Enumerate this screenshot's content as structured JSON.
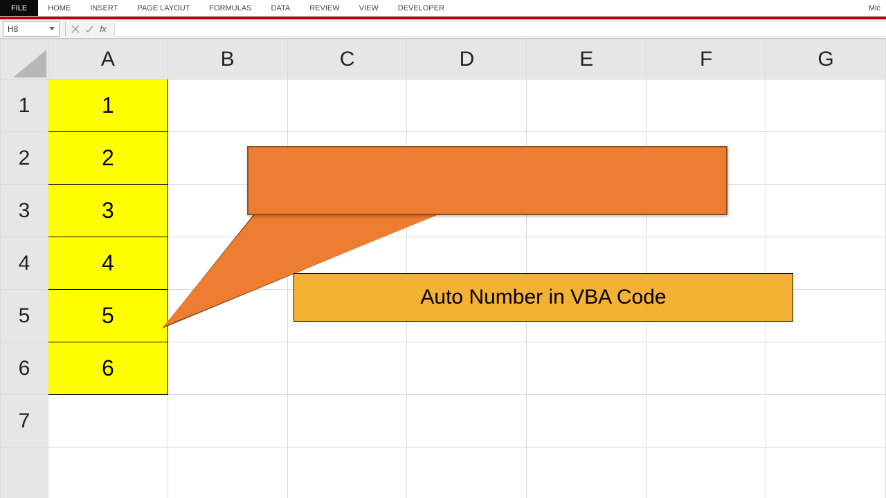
{
  "ribbon": {
    "file": "FILE",
    "tabs": [
      "HOME",
      "INSERT",
      "PAGE LAYOUT",
      "FORMULAS",
      "DATA",
      "REVIEW",
      "VIEW",
      "DEVELOPER"
    ],
    "title_right": "Mic"
  },
  "formula_bar": {
    "name_box": "H8",
    "formula": ""
  },
  "columns": [
    "A",
    "B",
    "C",
    "D",
    "E",
    "F",
    "G"
  ],
  "rows": [
    "1",
    "2",
    "3",
    "4",
    "5",
    "6",
    "7"
  ],
  "cells": {
    "A1": "1",
    "A2": "2",
    "A3": "3",
    "A4": "4",
    "A5": "5",
    "A6": "6"
  },
  "label_text": "Auto Number in VBA Code",
  "colors": {
    "yellow_fill": "#ffff00",
    "callout_fill": "#ed7d31",
    "callout_border": "#8f4e1e",
    "label_fill": "#f4b234"
  }
}
